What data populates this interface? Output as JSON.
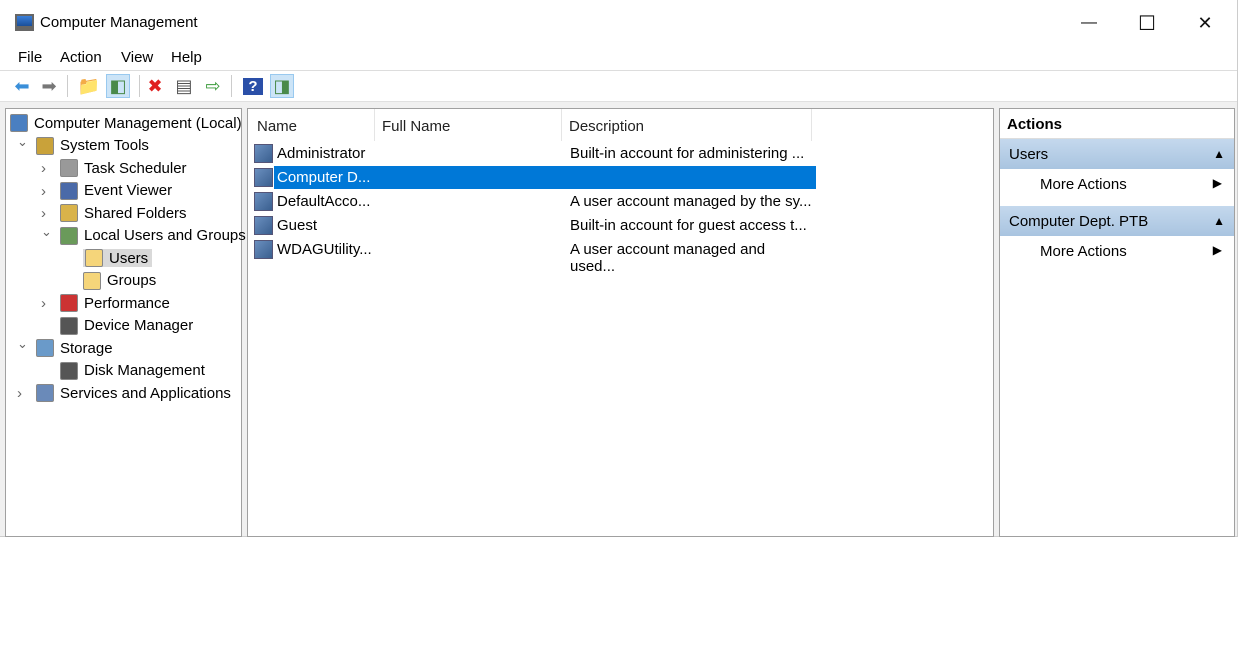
{
  "window": {
    "title": "Computer Management",
    "minimize": "—",
    "maximize": "☐",
    "close": "✕"
  },
  "menu": [
    "File",
    "Action",
    "View",
    "Help"
  ],
  "toolbar": [
    {
      "icon": "back-arrow-icon",
      "glyph": "⬅",
      "color": "#3a8fd9"
    },
    {
      "icon": "forward-arrow-icon",
      "glyph": "➡",
      "color": "#777"
    },
    {
      "icon": "up-folder-icon",
      "glyph": "📁",
      "color": "#d9b34a"
    },
    {
      "icon": "show-hide-console-tree-icon",
      "glyph": "◧",
      "color": "#4a8a4a"
    },
    {
      "icon": "delete-icon",
      "glyph": "✖",
      "color": "#e02020"
    },
    {
      "icon": "properties-icon",
      "glyph": "▤",
      "color": "#555"
    },
    {
      "icon": "export-list-icon",
      "glyph": "⇨",
      "color": "#3a9a3a"
    },
    {
      "icon": "help-icon",
      "glyph": "?",
      "color": "#fff"
    },
    {
      "icon": "show-hide-action-pane-icon",
      "glyph": "◨",
      "color": "#4a8a4a"
    }
  ],
  "tree": [
    {
      "label": "Computer Management (Local)",
      "level": 0,
      "expander": "",
      "icon": "computer-icon",
      "color": "#4a7fc1"
    },
    {
      "label": "System Tools",
      "level": 1,
      "expander": "⌄",
      "icon": "tools-icon",
      "color": "#c9a23a"
    },
    {
      "label": "Task Scheduler",
      "level": 2,
      "expander": "›",
      "icon": "clock-icon",
      "color": "#999"
    },
    {
      "label": "Event Viewer",
      "level": 2,
      "expander": "›",
      "icon": "event-viewer-icon",
      "color": "#4a6aa8"
    },
    {
      "label": "Shared Folders",
      "level": 2,
      "expander": "›",
      "icon": "shared-folder-icon",
      "color": "#d9b34a"
    },
    {
      "label": "Local Users and Groups",
      "level": 2,
      "expander": "⌄",
      "icon": "users-group-icon",
      "color": "#6a9a5a"
    },
    {
      "label": "Users",
      "level": 3,
      "expander": "",
      "icon": "folder-icon",
      "color": "#f5d57a",
      "selected": true
    },
    {
      "label": "Groups",
      "level": 3,
      "expander": "",
      "icon": "folder-icon",
      "color": "#f5d57a"
    },
    {
      "label": "Performance",
      "level": 2,
      "expander": "›",
      "icon": "performance-icon",
      "color": "#c33"
    },
    {
      "label": "Device Manager",
      "level": 2,
      "expander": "",
      "icon": "device-manager-icon",
      "color": "#555"
    },
    {
      "label": "Storage",
      "level": 1,
      "expander": "⌄",
      "icon": "storage-icon",
      "color": "#6a9ac9"
    },
    {
      "label": "Disk Management",
      "level": 2,
      "expander": "",
      "icon": "disk-icon",
      "color": "#555"
    },
    {
      "label": "Services and Applications",
      "level": 1,
      "expander": "›",
      "icon": "services-icon",
      "color": "#6a8ab9"
    }
  ],
  "list": {
    "columns": [
      "Name",
      "Full Name",
      "Description"
    ],
    "rows": [
      {
        "name": "Administrator",
        "full_name": "",
        "description": "Built-in account for administering ..."
      },
      {
        "name": "Computer D...",
        "full_name": "",
        "description": "",
        "selected": true
      },
      {
        "name": "DefaultAcco...",
        "full_name": "",
        "description": "A user account managed by the sy..."
      },
      {
        "name": "Guest",
        "full_name": "",
        "description": "Built-in account for guest access t..."
      },
      {
        "name": "WDAGUtility...",
        "full_name": "",
        "description": "A user account managed and used..."
      }
    ]
  },
  "actions": {
    "title": "Actions",
    "groups": [
      {
        "label": "Users",
        "collapse": "▲",
        "items": [
          {
            "label": "More Actions",
            "arrow": "▶"
          }
        ]
      },
      {
        "label": "Computer Dept. PTB",
        "collapse": "▲",
        "items": [
          {
            "label": "More Actions",
            "arrow": "▶"
          }
        ]
      }
    ]
  },
  "colors": {
    "selection": "#0078d7",
    "action_header": "#b4cde6"
  }
}
